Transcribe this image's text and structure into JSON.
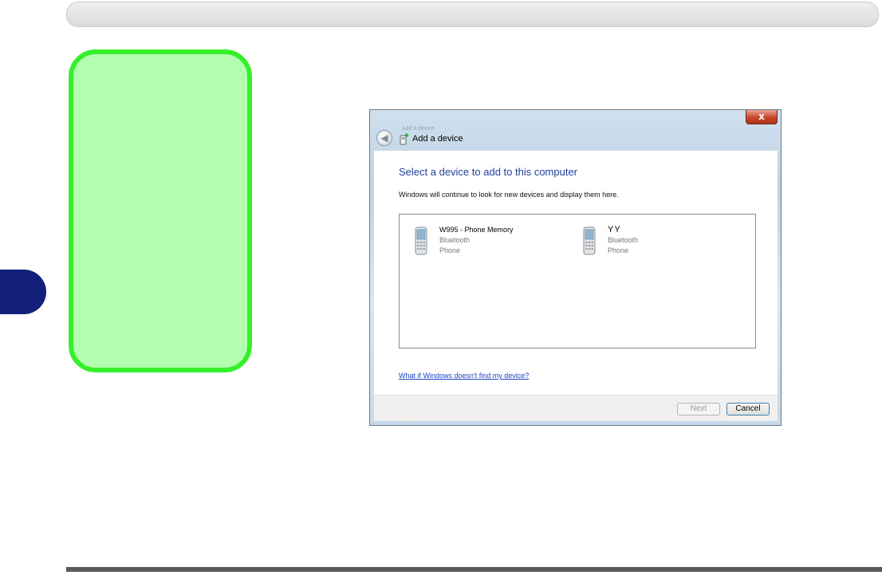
{
  "dialog": {
    "close_label": "x",
    "ghost_caption": "Add a device",
    "back_glyph": "◀",
    "title": "Add a device",
    "heading": "Select a device to add to this computer",
    "info": "Windows will continue to look for new devices and display them here.",
    "devices": [
      {
        "name": "W995 - Phone Memory",
        "type": "Bluetooth",
        "category": "Phone",
        "icon": "mobile-phone-icon"
      },
      {
        "name": "YY",
        "type": "Bluetooth",
        "category": "Phone",
        "icon": "mobile-phone-icon"
      }
    ],
    "help_link": "What if Windows doesn't find my device?",
    "buttons": {
      "next": "Next",
      "cancel": "Cancel"
    }
  },
  "colors": {
    "side_tab": "#13207a",
    "green_panel_fill": "#b3ffb0",
    "green_panel_border": "#36ef2b",
    "heading": "#1e3f9a",
    "link": "#1a44c4"
  }
}
